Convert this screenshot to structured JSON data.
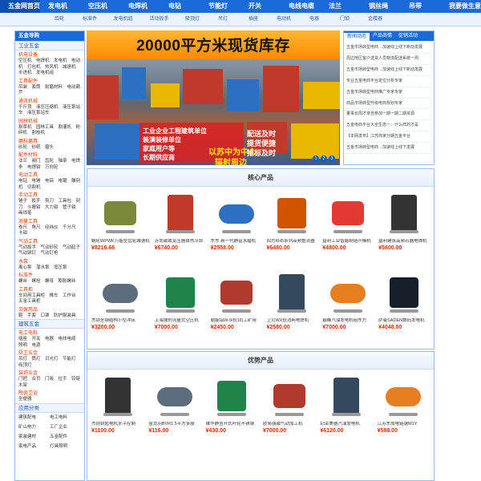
{
  "nav": {
    "items": [
      "五金网首页",
      "发电机",
      "空压机",
      "电焊机",
      "电钻",
      "节能灯",
      "开关",
      "电线电缆",
      "法兰",
      "钢丝绳",
      "吊带",
      "我要做生意"
    ]
  },
  "subnav": {
    "items": [
      "齿轮",
      "标准件",
      "发电机组",
      "活动扳手",
      "吸顶灯",
      "吊灯",
      "插座",
      "电动机",
      "电器",
      "门锁",
      "金楼器"
    ]
  },
  "sidebar": {
    "title": "五金导购",
    "section1": "工业五金",
    "categories": [
      {
        "name": "机电设备",
        "items": "空压机　电焊机　发电机　电动机　打包机　热风机　减速机　步进机　发电机组"
      },
      {
        "name": "工具配件",
        "items": "吊装　套筒　耐磨材料　电动葫芦"
      },
      {
        "name": "通讯机械",
        "items": "千斤顶　液压压缩机　液压泵站车　液压泵站车"
      },
      {
        "name": "园林机械",
        "items": "割草机　园林工具　割灌机　粉碎机　割枝机"
      },
      {
        "name": "磨料磨具",
        "items": "砂轮　砂纸　磨头"
      },
      {
        "name": "配件材料",
        "items": "法兰　阀门　齿轮　轴承　电焊条　电焊钳　万向轮"
      },
      {
        "name": "电动工具",
        "items": "电钻　电锤　电镐　电锯　雕刻机　切割机"
      },
      {
        "name": "手动工具",
        "items": "锤子　扳手　剪刀　工具包　刻刀　斗搬钳　大力钳　管子钳　画线笔"
      },
      {
        "name": "测量工具",
        "items": "卷尺　角尺　经纬仪　千分尺　卡钳"
      },
      {
        "name": "气动工具",
        "items": "气动扳手　气动砂轮　气动起子　气动铆钉　气动钉枪"
      },
      {
        "name": "水泵",
        "items": "离心泵　潜水泵　增压泵"
      },
      {
        "name": "标准件",
        "items": "螺丝　螺栓　螺母　膨胀螺丝"
      },
      {
        "name": "工具柜",
        "items": "车间用工具柜　推车　工作台　五金工具柜"
      },
      {
        "name": "劳保用品",
        "items": "鞋　手套　口罩　防护服装具"
      }
    ],
    "section2": "建筑五金",
    "categories2": [
      {
        "name": "电工电料",
        "items": "插座　开关　电器　电线电缆　照明　电源"
      },
      {
        "name": "厨卫五金",
        "items": "吊灯　筒灯　日光灯　节能灯　吸顶灯"
      },
      {
        "name": "装饰五金",
        "items": "门把　合页　门吸　拉手　铰链　木架"
      },
      {
        "name": "陶瓷卫浴",
        "items": "坐便器"
      }
    ],
    "section3": "应用分类",
    "apps": [
      "建筑配电",
      "电工电料",
      "矿山电力",
      "工厂企业",
      "家装建材",
      "五金配件",
      "家电产品",
      "灯具照明"
    ]
  },
  "banner": {
    "headline": "20000平方米现货库存",
    "left_lines": [
      "工业企业工程建筑单位",
      "装潢装修单位",
      "家庭用户等",
      "长期供应商"
    ],
    "right_lines": [
      "配送及时",
      "提货便捷",
      "推标及时"
    ],
    "bottom_lines": [
      "以苏中为中心",
      "辐射周边"
    ],
    "pages": [
      "1",
      "2",
      "3"
    ]
  },
  "news": {
    "tabs": [
      "新闻动态",
      "产品商情",
      "促销活动"
    ],
    "items": [
      "五金市场转型电商→加速线上线下新动发展",
      "周边地区客户送货人员物流配送系统一周",
      "五金市场转型电商→加速线上线下新动发展",
      "专业五金电商平台定位分析专家",
      "五金市场转型电商推广专家专家",
      "商品市场转型升级电商规划专家",
      "董事长周才亲自参加一期一期二期资源",
      "五金电商平台大全生态一：什么样的才是",
      "【本网发布】江苏商家分期五金平台",
      "五金市场转型电商→加速线上线下发展"
    ]
  },
  "section_core": {
    "title": "核心产品",
    "products": [
      {
        "name": "蜗轮WPWK万能型齿轮减速机",
        "price": "¥8216.66"
      },
      {
        "name": "苏尚磁致变压器自然冷却",
        "price": "¥6740.00"
      },
      {
        "name": "东东 新一代静音水磨机",
        "price": "¥2558.00"
      },
      {
        "name": "四方KH5系列高频整流器",
        "price": "¥6480.00"
      },
      {
        "name": "益利工业智能制造开模机",
        "price": "¥4800.00"
      },
      {
        "name": "益利建筑高频石器电焊机",
        "price": "¥5800.00"
      },
      {
        "name": "杰钥全钢结构小型冲床",
        "price": "¥3200.00"
      },
      {
        "name": "上海捷豹流量式空压机",
        "price": "¥7000.00"
      },
      {
        "name": "勒能铝W-9/8(16)工矿用",
        "price": "¥2450.00"
      },
      {
        "name": "卫贝WX低消耗电焊机",
        "price": "¥2580.00"
      },
      {
        "name": "巅峰汽油发电机组东方",
        "price": "¥7000.00"
      },
      {
        "name": "萨曼SADEN数码发电机",
        "price": "¥4048.00"
      }
    ]
  },
  "section_adv": {
    "title": "优势产品",
    "products": [
      {
        "name": "杰钥钥匙电机水平控制",
        "price": "¥1100.00"
      },
      {
        "name": "金龙羽BVR1.5平方多股",
        "price": "¥116.00"
      },
      {
        "name": "维华静吉开式叶轮不锈钢",
        "price": "¥430.00"
      },
      {
        "name": "欧易强磁气动加工机",
        "price": "¥7000.00"
      },
      {
        "name": "ESE美德汽油发电机",
        "price": "¥6120.00"
      },
      {
        "name": "江苏东成电链锯M1Y",
        "price": "¥588.00"
      }
    ]
  }
}
